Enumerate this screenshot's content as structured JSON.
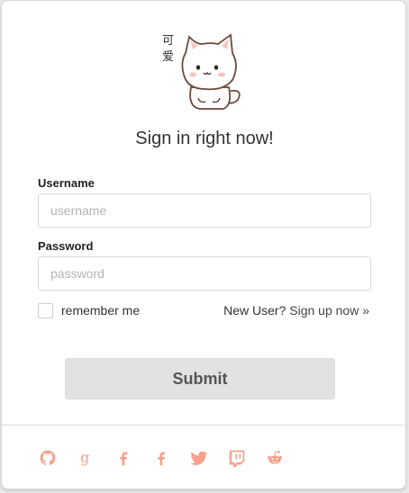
{
  "header": {
    "title": "Sign in right now!",
    "mascot_text": "可爱"
  },
  "form": {
    "username_label": "Username",
    "username_placeholder": "username",
    "password_label": "Password",
    "password_placeholder": "password",
    "remember_label": "remember me",
    "new_user_text": "New User?",
    "signup_link": "Sign up now »",
    "submit_label": "Submit"
  },
  "social": {
    "accent_color": "#f7a08a",
    "icons": [
      "github-icon",
      "google-icon",
      "facebook-icon",
      "facebook-icon",
      "twitter-icon",
      "twitch-icon",
      "reddit-icon"
    ]
  }
}
